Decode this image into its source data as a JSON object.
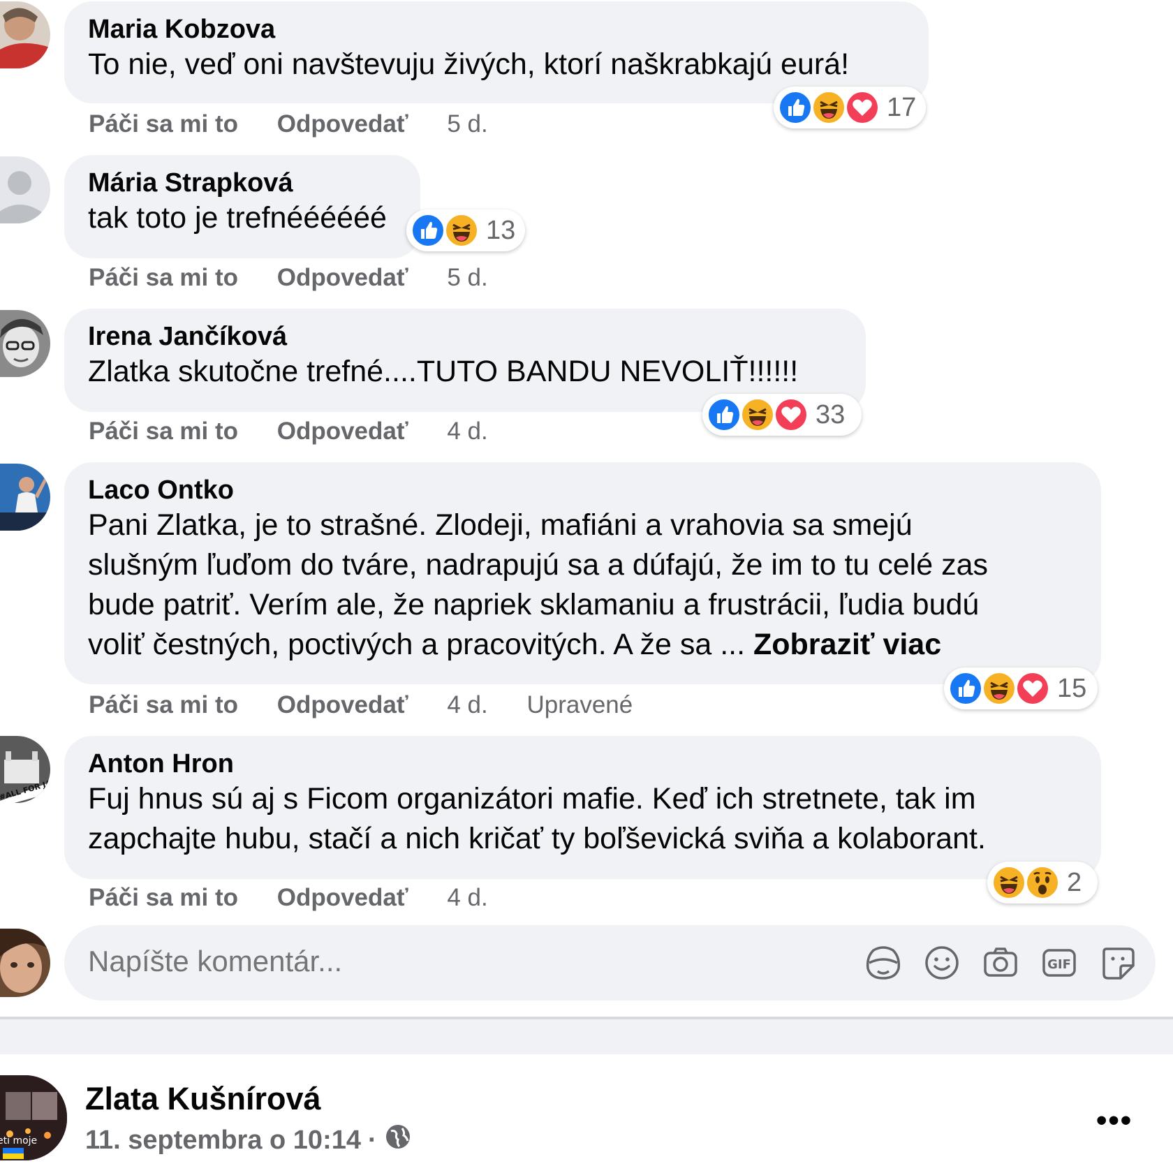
{
  "comments": [
    {
      "author": "Maria Kobzova",
      "text": "To nie, veď oni navštevuju živých, ktorí naškrabkajú eurá!",
      "more": "",
      "like_label": "Páči sa mi to",
      "reply_label": "Odpovedať",
      "time": "5 d.",
      "edited": "",
      "reactions": [
        "like",
        "haha",
        "love"
      ],
      "reaction_count": "17"
    },
    {
      "author": "Mária Strapková",
      "text": "tak toto je trefnéééééé",
      "more": "",
      "like_label": "Páči sa mi to",
      "reply_label": "Odpovedať",
      "time": "5 d.",
      "edited": "",
      "reactions": [
        "like",
        "haha"
      ],
      "reaction_count": "13"
    },
    {
      "author": "Irena Jančíková",
      "text": "Zlatka skutočne trefné....TUTO BANDU NEVOLIŤ!!!!!!",
      "more": "",
      "like_label": "Páči sa mi to",
      "reply_label": "Odpovedať",
      "time": "4 d.",
      "edited": "",
      "reactions": [
        "like",
        "haha",
        "love"
      ],
      "reaction_count": "33"
    },
    {
      "author": "Laco Ontko",
      "text": "Pani Zlatka, je to strašné. Zlodeji, mafiáni a vrahovia sa smejú\nslušným ľuďom do tváre, nadrapujú sa a dúfajú, že im to tu celé zas\nbude patriť. Verím ale, že napriek sklamaniu a frustrácii, ľudia budú\nvoliť čestných, poctivých a pracovitých. A že sa ... ",
      "more": "Zobraziť viac",
      "like_label": "Páči sa mi to",
      "reply_label": "Odpovedať",
      "time": "4 d.",
      "edited": "Upravené",
      "reactions": [
        "like",
        "haha",
        "love"
      ],
      "reaction_count": "15"
    },
    {
      "author": "Anton Hron",
      "text": "Fuj hnus sú aj s Ficom organizátori mafie. Keď ich stretnete, tak im\nzapchajte hubu, stačí a nich kričať ty boľševická sviňa a kolaborant.",
      "more": "",
      "like_label": "Páči sa mi to",
      "reply_label": "Odpovedať",
      "time": "4 d.",
      "edited": "",
      "reactions": [
        "haha",
        "wow"
      ],
      "reaction_count": "2"
    }
  ],
  "avatar_texts": {
    "anton": "#ALL FOR JAN",
    "post": "eti moje"
  },
  "composer": {
    "placeholder": "Napíšte komentár...",
    "icons": [
      "avatar-sticker-icon",
      "emoji-icon",
      "camera-icon",
      "gif-icon",
      "sticker-icon"
    ],
    "gif_label": "GIF"
  },
  "post": {
    "author": "Zlata Kušnírová",
    "date": "11. septembra o 10:14",
    "separator": "·",
    "privacy_icon": "globe-icon",
    "more_label": "•••"
  },
  "colors": {
    "bubble": "#f0f2f5",
    "secondary_text": "#65676b",
    "like_blue": "#1877f2",
    "love_red": "#f33e58",
    "haha_yellow": "#f7b125"
  }
}
